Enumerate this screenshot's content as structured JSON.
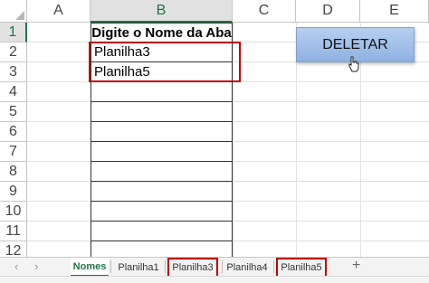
{
  "columns": [
    "A",
    "B",
    "C",
    "D",
    "E"
  ],
  "rows": [
    "1",
    "2",
    "3",
    "4",
    "5",
    "6",
    "7",
    "8",
    "9",
    "10",
    "11",
    "12"
  ],
  "cells": {
    "B1": "Digite o Nome da Aba",
    "B2": "Planilha3",
    "B3": "Planilha5"
  },
  "button": {
    "label": "DELETAR"
  },
  "tabs": [
    "Nomes",
    "Planilha1",
    "Planilha3",
    "Planilha4",
    "Planilha5"
  ],
  "active_tab": "Nomes",
  "highlighted_tabs": [
    "Planilha3",
    "Planilha5"
  ],
  "highlight_color": "#c00000",
  "accent_color": "#217346"
}
